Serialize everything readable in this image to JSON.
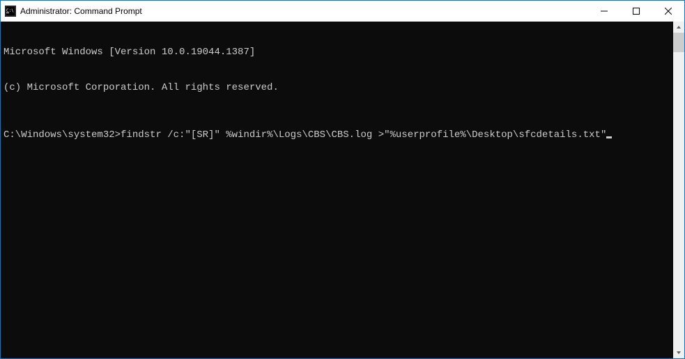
{
  "titlebar": {
    "title": "Administrator: Command Prompt"
  },
  "terminal": {
    "line1": "Microsoft Windows [Version 10.0.19044.1387]",
    "line2": "(c) Microsoft Corporation. All rights reserved.",
    "prompt": "C:\\Windows\\system32>",
    "command": "findstr /c:\"[SR]\" %windir%\\Logs\\CBS\\CBS.log >\"%userprofile%\\Desktop\\sfcdetails.txt\""
  }
}
